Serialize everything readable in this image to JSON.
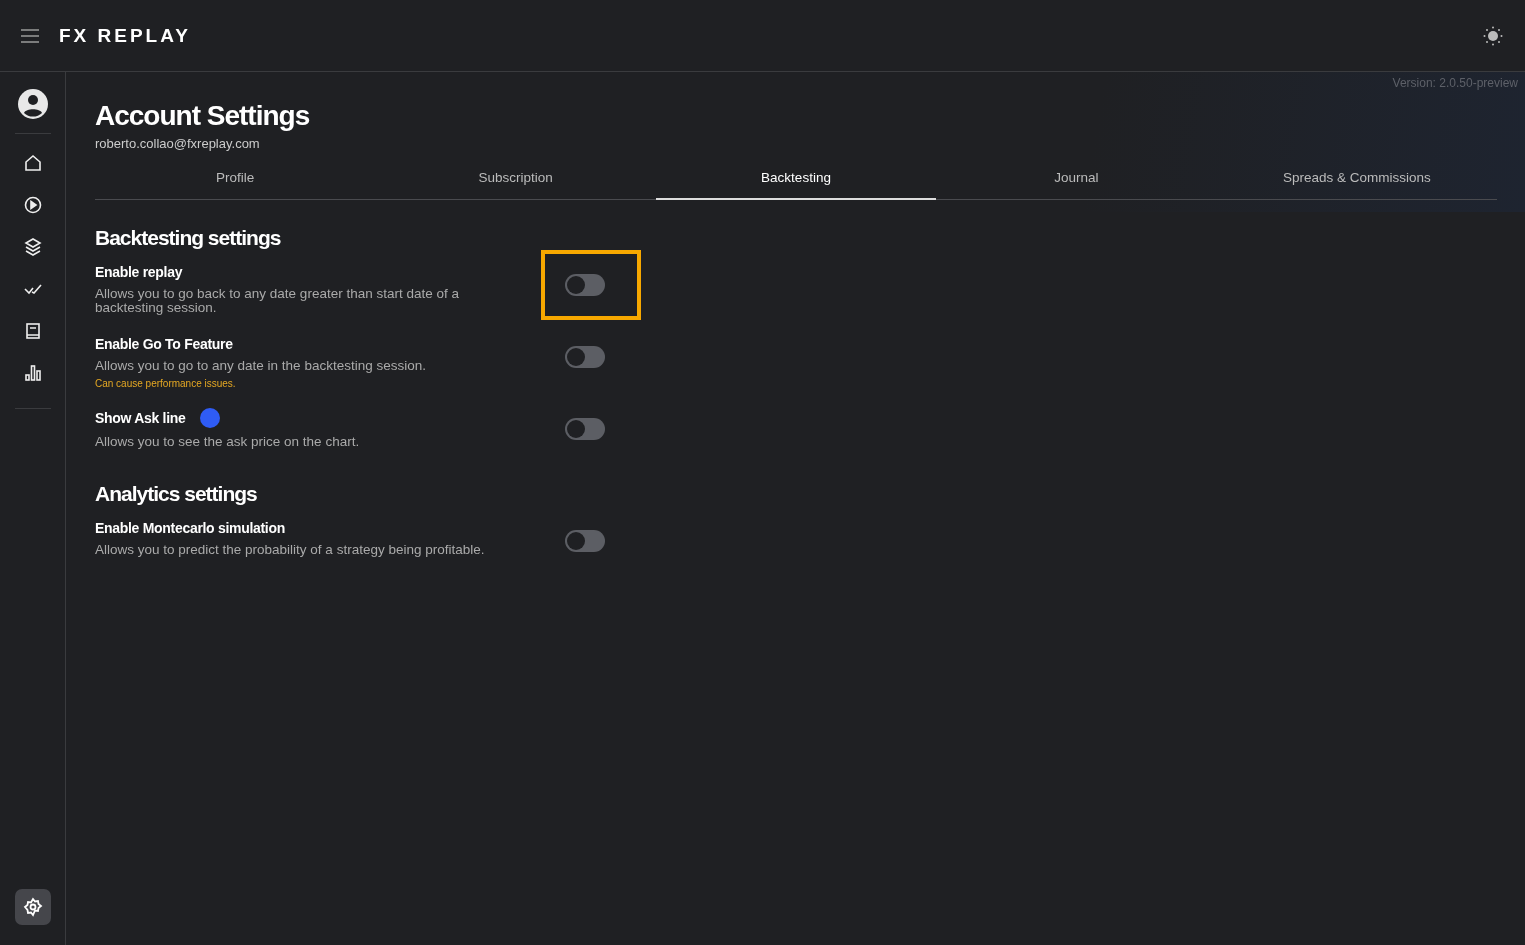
{
  "header": {
    "logo": "FX REPLAY"
  },
  "sidebar": {
    "items": [
      {
        "selected": false
      },
      {
        "selected": false
      },
      {
        "selected": false
      },
      {
        "selected": false
      },
      {
        "selected": false
      },
      {
        "selected": false
      }
    ]
  },
  "version": "Version: 2.0.50-preview",
  "page": {
    "title": "Account Settings",
    "email": "roberto.collao@fxreplay.com"
  },
  "tabs": [
    {
      "label": "Profile",
      "selected": false
    },
    {
      "label": "Subscription",
      "selected": false
    },
    {
      "label": "Backtesting",
      "selected": true
    },
    {
      "label": "Journal",
      "selected": false
    },
    {
      "label": "Spreads & Commissions",
      "selected": false
    }
  ],
  "sections": [
    {
      "title": "Backtesting settings",
      "settings": [
        {
          "label": "Enable replay",
          "description": "Allows you to go back to any date greater than start date of a backtesting session.",
          "on": false,
          "highlighted": true
        },
        {
          "label": "Enable Go To Feature",
          "description": "Allows you to go to any date in the backtesting session.",
          "warning": "Can cause performance issues.",
          "on": false,
          "highlighted": false
        },
        {
          "label": "Show Ask line",
          "color": "#2f5cf5",
          "description": "Allows you to see the ask price on the chart.",
          "on": false,
          "highlighted": false
        }
      ]
    },
    {
      "title": "Analytics settings",
      "settings": [
        {
          "label": "Enable Montecarlo simulation",
          "description": "Allows you to predict the probability of a strategy being profitable.",
          "on": false,
          "highlighted": false
        }
      ]
    }
  ]
}
